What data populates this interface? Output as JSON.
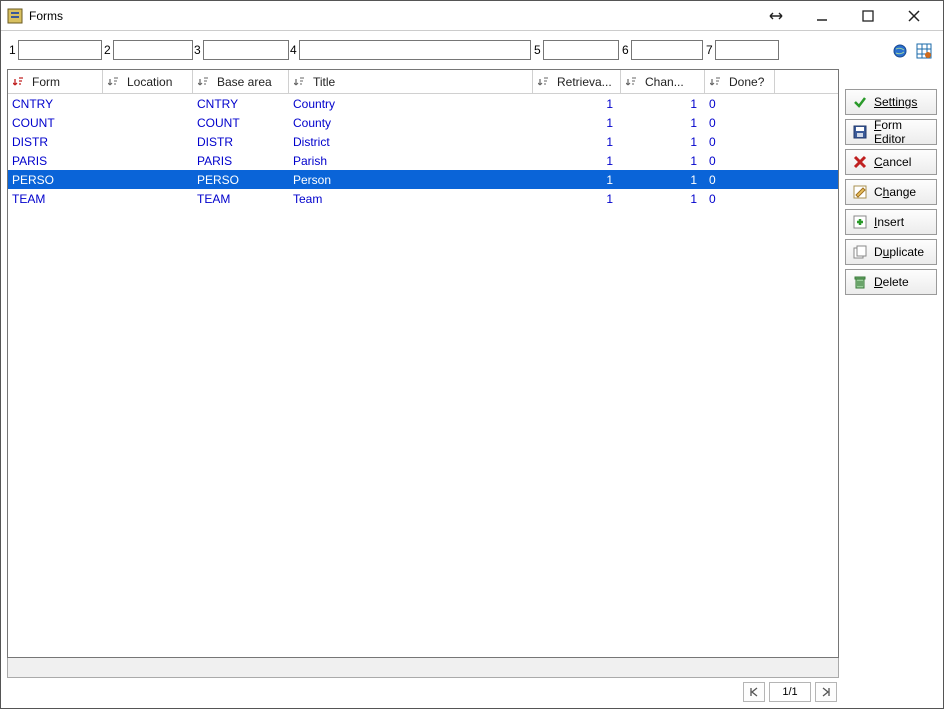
{
  "window": {
    "title": "Forms"
  },
  "filters": [
    {
      "num": "1",
      "value": ""
    },
    {
      "num": "2",
      "value": ""
    },
    {
      "num": "3",
      "value": ""
    },
    {
      "num": "4",
      "value": ""
    },
    {
      "num": "5",
      "value": ""
    },
    {
      "num": "6",
      "value": ""
    },
    {
      "num": "7",
      "value": ""
    }
  ],
  "columns": {
    "form": "Form",
    "location": "Location",
    "base_area": "Base area",
    "title": "Title",
    "retrieval": "Retrieva...",
    "changes": "Chan...",
    "done": "Done?"
  },
  "rows": [
    {
      "form": "CNTRY",
      "location": "",
      "base": "CNTRY",
      "title": "Country",
      "ret": "1",
      "chan": "1",
      "done": "0",
      "selected": false
    },
    {
      "form": "COUNT",
      "location": "",
      "base": "COUNT",
      "title": "County",
      "ret": "1",
      "chan": "1",
      "done": "0",
      "selected": false
    },
    {
      "form": "DISTR",
      "location": "",
      "base": "DISTR",
      "title": "District",
      "ret": "1",
      "chan": "1",
      "done": "0",
      "selected": false
    },
    {
      "form": "PARIS",
      "location": "",
      "base": "PARIS",
      "title": "Parish",
      "ret": "1",
      "chan": "1",
      "done": "0",
      "selected": false
    },
    {
      "form": "PERSO",
      "location": "",
      "base": "PERSO",
      "title": "Person",
      "ret": "1",
      "chan": "1",
      "done": "0",
      "selected": true
    },
    {
      "form": "TEAM",
      "location": "",
      "base": "TEAM",
      "title": "Team",
      "ret": "1",
      "chan": "1",
      "done": "0",
      "selected": false
    }
  ],
  "pager": {
    "text": "1/1"
  },
  "buttons": {
    "settings": "Settings",
    "form_editor": "Form Editor",
    "cancel": "Cancel",
    "change": "Change",
    "insert": "Insert",
    "duplicate": "Duplicate",
    "delete": "Delete"
  }
}
